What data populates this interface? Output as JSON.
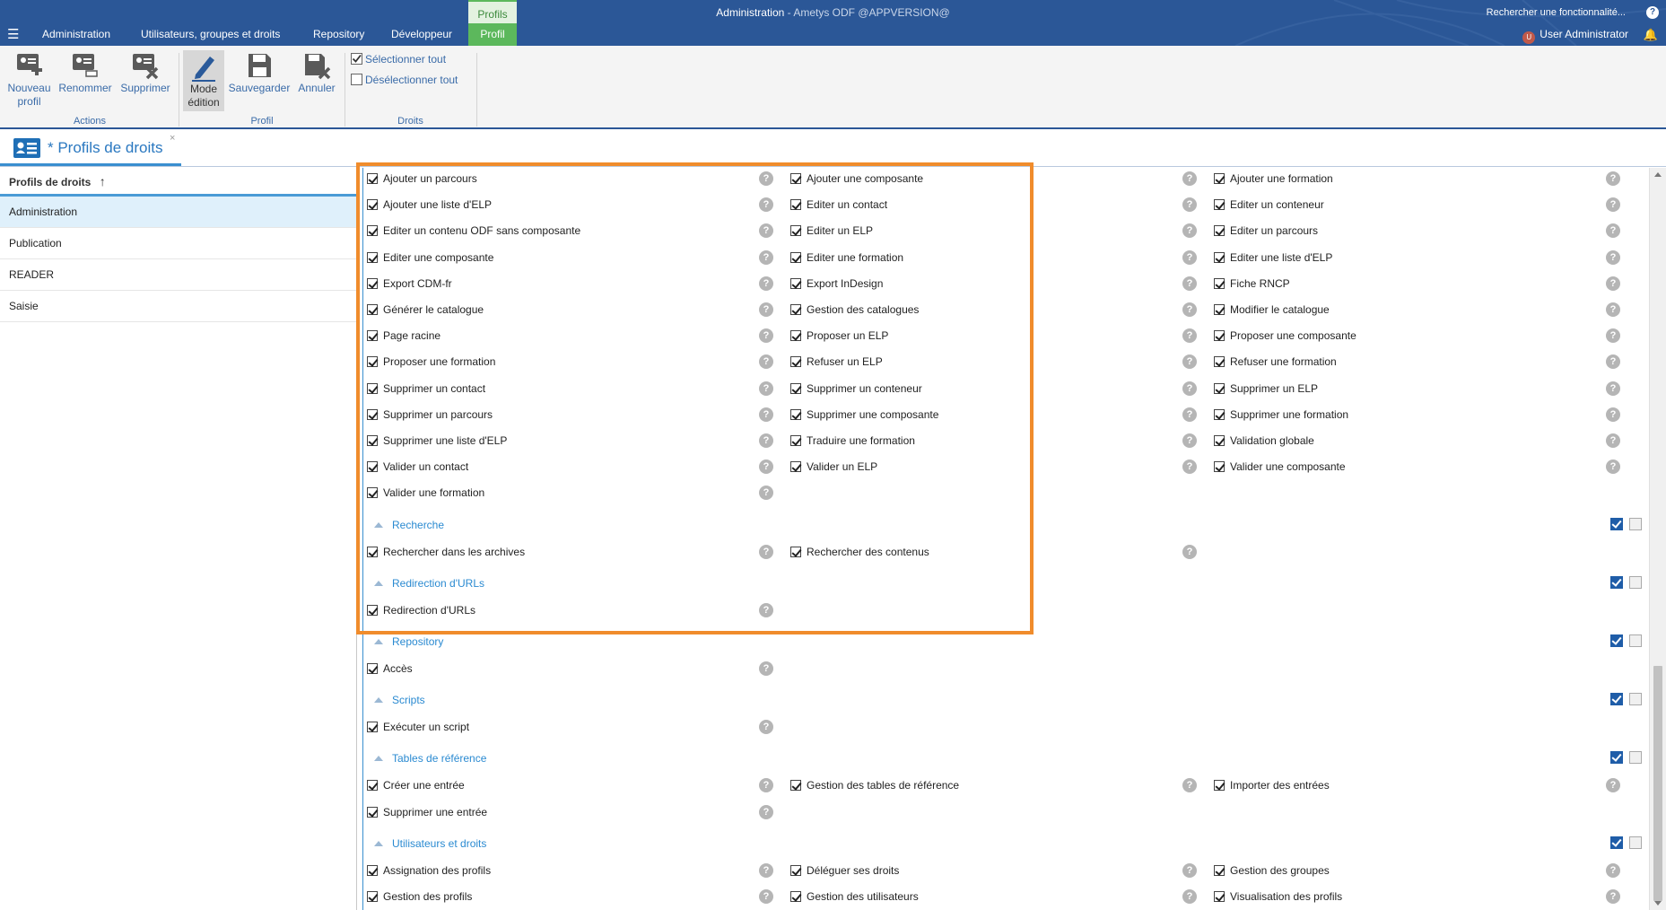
{
  "topbar": {
    "tabs": [
      "Administration",
      "Utilisateurs, groupes et droits",
      "Repository",
      "Développeur"
    ],
    "context_group": "Profils",
    "context_tab": "Profil",
    "title_main": "Administration",
    "title_rest": " - Ametys ODF @APPVERSION@",
    "search_placeholder": "Rechercher une fonctionnalité...",
    "help": "?",
    "user_initial": "U",
    "user_name": "User Administrator",
    "accent_color": "#2b5797"
  },
  "ribbon": {
    "new_profile_1": "Nouveau",
    "new_profile_2": "profil",
    "rename": "Renommer",
    "delete": "Supprimer",
    "group_actions": "Actions",
    "edit_mode_1": "Mode",
    "edit_mode_2": "édition",
    "save": "Sauvegarder",
    "cancel": "Annuler",
    "group_profil": "Profil",
    "select_all": "Sélectionner tout",
    "deselect_all": "Désélectionner tout",
    "group_rights": "Droits"
  },
  "tool_tab": {
    "label": "* Profils de droits",
    "close": "×"
  },
  "profiles_grid": {
    "header": "Profils de droits",
    "sort_icon": "↑",
    "rows": [
      "Administration",
      "Publication",
      "READER",
      "Saisie"
    ]
  },
  "rights": {
    "rows": [
      [
        "Ajouter un parcours",
        "Ajouter une composante",
        "Ajouter une formation"
      ],
      [
        "Ajouter une liste d'ELP",
        "Editer un contact",
        "Editer un conteneur"
      ],
      [
        "Editer un contenu ODF sans composante",
        "Editer un ELP",
        "Editer un parcours"
      ],
      [
        "Editer une composante",
        "Editer une formation",
        "Editer une liste d'ELP"
      ],
      [
        "Export CDM-fr",
        "Export InDesign",
        "Fiche RNCP"
      ],
      [
        "Générer le catalogue",
        "Gestion des catalogues",
        "Modifier le catalogue"
      ],
      [
        "Page racine",
        "Proposer un ELP",
        "Proposer une composante"
      ],
      [
        "Proposer une formation",
        "Refuser un ELP",
        "Refuser une formation"
      ],
      [
        "Supprimer un contact",
        "Supprimer un conteneur",
        "Supprimer un ELP"
      ],
      [
        "Supprimer un parcours",
        "Supprimer une composante",
        "Supprimer une formation"
      ],
      [
        "Supprimer une liste d'ELP",
        "Traduire une formation",
        "Validation globale"
      ],
      [
        "Valider un contact",
        "Valider un ELP",
        "Valider une composante"
      ],
      [
        "Valider une formation"
      ]
    ],
    "categories": [
      {
        "title": "Recherche",
        "items": [
          [
            "Rechercher dans les archives",
            "Rechercher des contenus"
          ]
        ]
      },
      {
        "title": "Redirection d'URLs",
        "items": [
          [
            "Redirection d'URLs"
          ]
        ]
      },
      {
        "title": "Repository",
        "items": [
          [
            "Accès"
          ]
        ]
      },
      {
        "title": "Scripts",
        "items": [
          [
            "Exécuter un script"
          ]
        ]
      },
      {
        "title": "Tables de référence",
        "items": [
          [
            "Créer une entrée",
            "Gestion des tables de référence",
            "Importer des entrées"
          ],
          [
            "Supprimer une entrée"
          ]
        ]
      },
      {
        "title": "Utilisateurs et droits",
        "items": [
          [
            "Assignation des profils",
            "Déléguer ses droits",
            "Gestion des groupes"
          ],
          [
            "Gestion des profils",
            "Gestion des utilisateurs",
            "Visualisation des profils"
          ]
        ]
      }
    ]
  },
  "highlight_color": "#f08c2c"
}
